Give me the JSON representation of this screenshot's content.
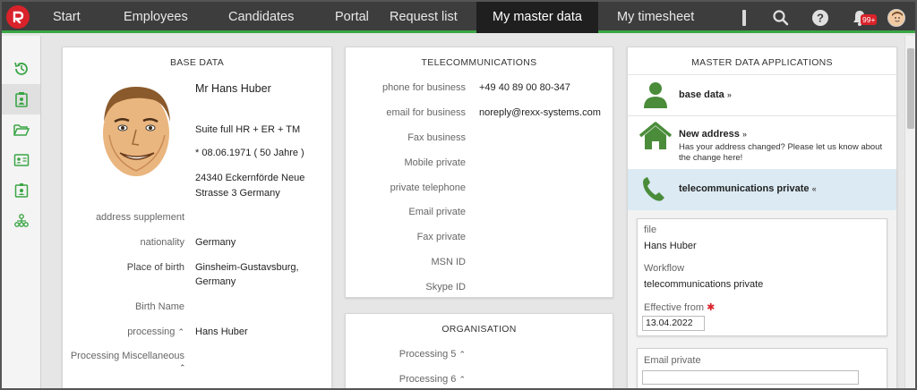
{
  "nav": {
    "items": [
      "Start",
      "Employees",
      "Candidates",
      "Portal",
      "Request list",
      "My master data",
      "My timesheet"
    ],
    "badge": "99+"
  },
  "base_data": {
    "title": "BASE DATA",
    "name": "Mr Hans Huber",
    "suite": "Suite full HR + ER + TM",
    "birth": "* 08.06.1971  ( 50 Jahre )",
    "address_line1": "24340 Eckernförde Neue",
    "address_line2": "Strasse 3 Germany",
    "address_supplement_label": "address supplement",
    "nationality_label": "nationality",
    "nationality_value": "Germany",
    "place_of_birth_label": "Place of birth",
    "place_of_birth_line1": "Ginsheim-Gustavsburg,",
    "place_of_birth_line2": "Germany",
    "birth_name_label": "Birth Name",
    "processing_label": "processing",
    "processing_value": "Hans Huber",
    "processing_misc_label": "Processing Miscellaneous"
  },
  "telecom": {
    "title": "TELECOMMUNICATIONS",
    "rows": [
      {
        "label": "phone for business",
        "value": "+49 40 89 00 80-347"
      },
      {
        "label": "email for business",
        "value": "noreply@rexx-systems.com"
      },
      {
        "label": "Fax business",
        "value": ""
      },
      {
        "label": "Mobile private",
        "value": ""
      },
      {
        "label": "private telephone",
        "value": ""
      },
      {
        "label": "Email private",
        "value": ""
      },
      {
        "label": "Fax private",
        "value": ""
      },
      {
        "label": "MSN ID",
        "value": ""
      },
      {
        "label": "Skype ID",
        "value": ""
      }
    ]
  },
  "organisation": {
    "title": "ORGANISATION",
    "processing5": "Processing 5",
    "processing6": "Processing 6"
  },
  "apps": {
    "title": "MASTER DATA APPLICATIONS",
    "base_data": "base data",
    "new_address": "New address",
    "new_address_desc": "Has your address changed? Please let us know about the change here!",
    "telecom_private": "telecommunications private",
    "file_label": "file",
    "file_value": "Hans Huber",
    "workflow_label": "Workflow",
    "workflow_value": "telecommunications private",
    "effective_label": "Effective from",
    "effective_value": "13.04.2022",
    "email_private_label": "Email private"
  },
  "colors": {
    "accent_green": "#3aa545",
    "icon_green": "#4a8c3a",
    "highlight_blue": "#dbeaf3",
    "required_red": "#d9222a"
  }
}
